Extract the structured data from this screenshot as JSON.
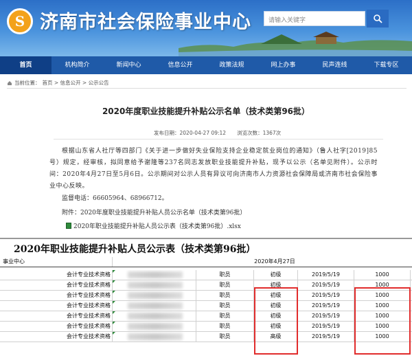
{
  "header": {
    "logo_glyph": "S",
    "title": "济南市社会保险事业中心",
    "search_placeholder": "请输入关键字"
  },
  "nav": {
    "items": [
      "首页",
      "机构简介",
      "新闻中心",
      "信息公开",
      "政策法规",
      "网上办事",
      "民声连线",
      "下载专区"
    ]
  },
  "breadcrumb": {
    "label": "当前位置：",
    "path": "首页 > 信息公开 > 公示公告"
  },
  "article": {
    "title": "2020年度职业技能提升补贴公示名单（技术类第96批）",
    "publish_date": "发布日期：2020-04-27 09:12",
    "views": "浏览次数：1367次",
    "body": "根据山东省人社厅等四部门《关于进一步做好失业保险支持企业稳定就业岗位的通知》（鲁人社字[2019]85号）规定，经审核，拟同意给予谢隆等237名同志发放职业技能提升补贴，现予以公示（名单见附件）。公示时间：2020年4月27日至5月6日。公示期间对公示人员有异议可向济南市人力资源社会保障局或济南市社会保险事业中心反映。",
    "phone": "监督电话：66605964、68966712。",
    "attachment_line": "附件：2020年度职业技能提升补贴人员公示名单（技术类第96批）",
    "attachment_file": "2020年职业技能提升补贴人员公示表（技术类第96批）.xlsx"
  },
  "sheet": {
    "title": "2020年职业技能提升补贴人员公示表（技术类第96批）",
    "org_label": "事业中心",
    "date_label": "2020年4月27日",
    "rows": [
      {
        "item": "会计专业技术资格",
        "role": "职员",
        "level": "初级",
        "date": "2019/5/19",
        "amount": "1000"
      },
      {
        "item": "会计专业技术资格",
        "role": "职员",
        "level": "初级",
        "date": "2019/5/19",
        "amount": "1000"
      },
      {
        "item": "会计专业技术资格",
        "role": "职员",
        "level": "初级",
        "date": "2019/5/19",
        "amount": "1000"
      },
      {
        "item": "会计专业技术资格",
        "role": "职员",
        "level": "初级",
        "date": "2019/5/19",
        "amount": "1000"
      },
      {
        "item": "会计专业技术资格",
        "role": "职员",
        "level": "初级",
        "date": "2019/5/19",
        "amount": "1000"
      },
      {
        "item": "会计专业技术资格",
        "role": "职员",
        "level": "初级",
        "date": "2019/5/19",
        "amount": "1000"
      },
      {
        "item": "会计专业技术资格",
        "role": "职员",
        "level": "高级",
        "date": "2019/5/19",
        "amount": "1000"
      }
    ]
  },
  "colors": {
    "header_blue": "#2c6fc7",
    "nav_blue": "#1f5aa8",
    "highlight_red": "#e12b2b"
  }
}
